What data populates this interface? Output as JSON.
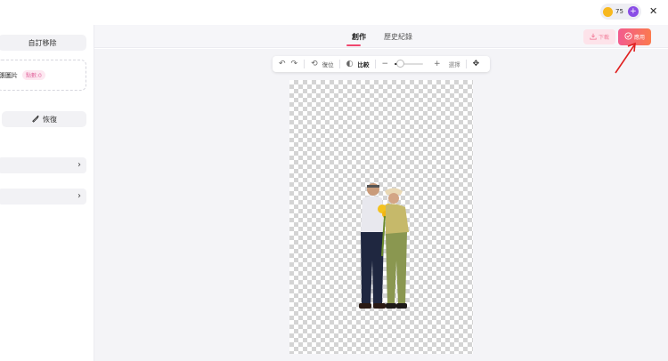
{
  "left_panel": {
    "custom_remove_label": "自訂移除",
    "upload_text": "張圖片",
    "upload_badge": "點數:0",
    "restore_label": "恢復"
  },
  "tabs": [
    {
      "label": "創作",
      "active": true
    },
    {
      "label": "歷史紀錄",
      "active": false
    }
  ],
  "actions": {
    "download_label": "下載",
    "apply_label": "應用"
  },
  "header": {
    "credits": "75"
  },
  "toolbar": {
    "reset_label": "復位",
    "compare_label": "比較",
    "erase_label": "選擇"
  },
  "zoom_level": 0.2,
  "colors": {
    "accent": "#f0466e",
    "apply_gradient_start": "#f25b8f",
    "apply_gradient_end": "#fb7a4e",
    "credit_plus": "#8a4de6"
  }
}
